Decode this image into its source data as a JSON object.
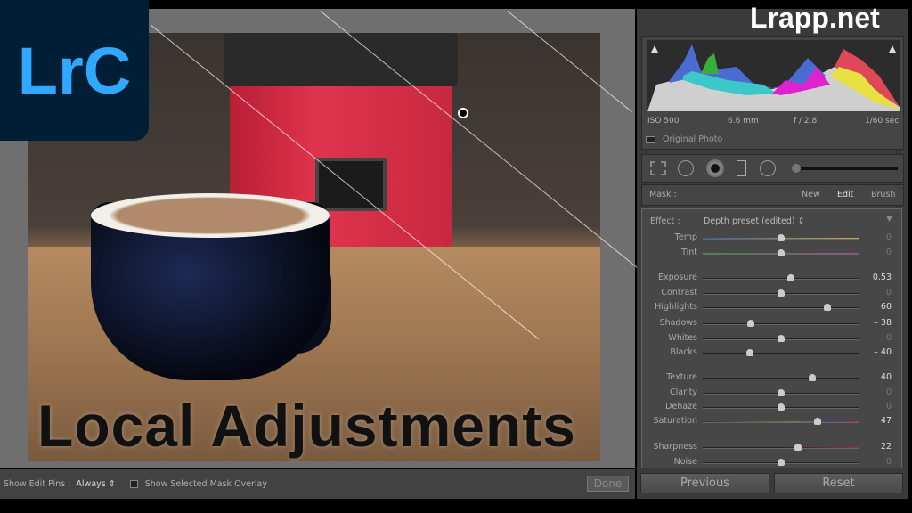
{
  "logo": {
    "text": "LrC"
  },
  "watermark": "Lrapp.net",
  "title": "Local Adjustments",
  "histogram": {
    "iso": "ISO 500",
    "focal": "6.6 mm",
    "aperture": "f / 2.8",
    "shutter": "1/60 sec",
    "original_photo": "Original Photo"
  },
  "mask": {
    "label": "Mask :",
    "new": "New",
    "edit": "Edit",
    "brush": "Brush"
  },
  "effect": {
    "label": "Effect :",
    "preset": "Depth preset (edited)"
  },
  "sliders": [
    {
      "label": "Temp",
      "value": "0",
      "num": 0,
      "min": -100,
      "max": 100
    },
    {
      "label": "Tint",
      "value": "0",
      "num": 0,
      "min": -100,
      "max": 100
    },
    {
      "label": "Exposure",
      "value": "0.53",
      "num": 0.53,
      "min": -4,
      "max": 4
    },
    {
      "label": "Contrast",
      "value": "0",
      "num": 0,
      "min": -100,
      "max": 100
    },
    {
      "label": "Highlights",
      "value": "60",
      "num": 60,
      "min": -100,
      "max": 100
    },
    {
      "label": "Shadows",
      "value": "– 38",
      "num": -38,
      "min": -100,
      "max": 100
    },
    {
      "label": "Whites",
      "value": "0",
      "num": 0,
      "min": -100,
      "max": 100
    },
    {
      "label": "Blacks",
      "value": "– 40",
      "num": -40,
      "min": -100,
      "max": 100
    },
    {
      "label": "Texture",
      "value": "40",
      "num": 40,
      "min": -100,
      "max": 100
    },
    {
      "label": "Clarity",
      "value": "0",
      "num": 0,
      "min": -100,
      "max": 100
    },
    {
      "label": "Dehaze",
      "value": "0",
      "num": 0,
      "min": -100,
      "max": 100
    },
    {
      "label": "Saturation",
      "value": "47",
      "num": 47,
      "min": -100,
      "max": 100
    },
    {
      "label": "Sharpness",
      "value": "22",
      "num": 22,
      "min": -100,
      "max": 100
    },
    {
      "label": "Noise",
      "value": "0",
      "num": 0,
      "min": -100,
      "max": 100
    }
  ],
  "toolbar": {
    "show_edit_pins": "Show Edit Pins :",
    "pins_value": "Always",
    "overlay": "Show Selected Mask Overlay",
    "done": "Done"
  },
  "buttons": {
    "previous": "Previous",
    "reset": "Reset"
  },
  "colors": {
    "logo_bg": "#001e36",
    "logo_fg": "#31a8ff",
    "panel": "#3a3a3a"
  }
}
